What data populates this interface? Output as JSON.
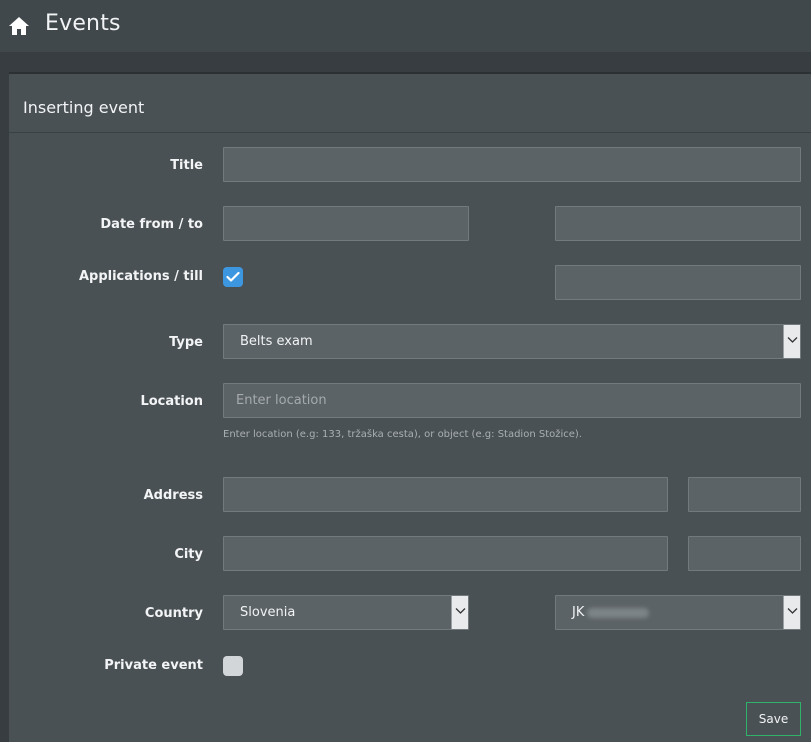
{
  "header": {
    "icon": "home-icon",
    "title": "Events"
  },
  "panel": {
    "title": "Inserting event"
  },
  "form": {
    "title": {
      "label": "Title",
      "value": ""
    },
    "date": {
      "label": "Date from / to",
      "from": "",
      "to": ""
    },
    "applications": {
      "label": "Applications / till",
      "checked": true,
      "till": ""
    },
    "type": {
      "label": "Type",
      "value": "Belts exam"
    },
    "location": {
      "label": "Location",
      "placeholder": "Enter location",
      "help": "Enter location (e.g: 133, tržaška cesta), or object (e.g: Stadion Stožice)."
    },
    "address": {
      "label": "Address",
      "street": "",
      "number": ""
    },
    "city": {
      "label": "City",
      "name": "",
      "postal": ""
    },
    "country": {
      "label": "Country",
      "value": "Slovenia",
      "club_prefix": "JK"
    },
    "private": {
      "label": "Private event",
      "checked": false
    }
  },
  "actions": {
    "save_label": "Save"
  },
  "colors": {
    "accent": "#3d97e0",
    "save_border": "#2fb36b"
  }
}
